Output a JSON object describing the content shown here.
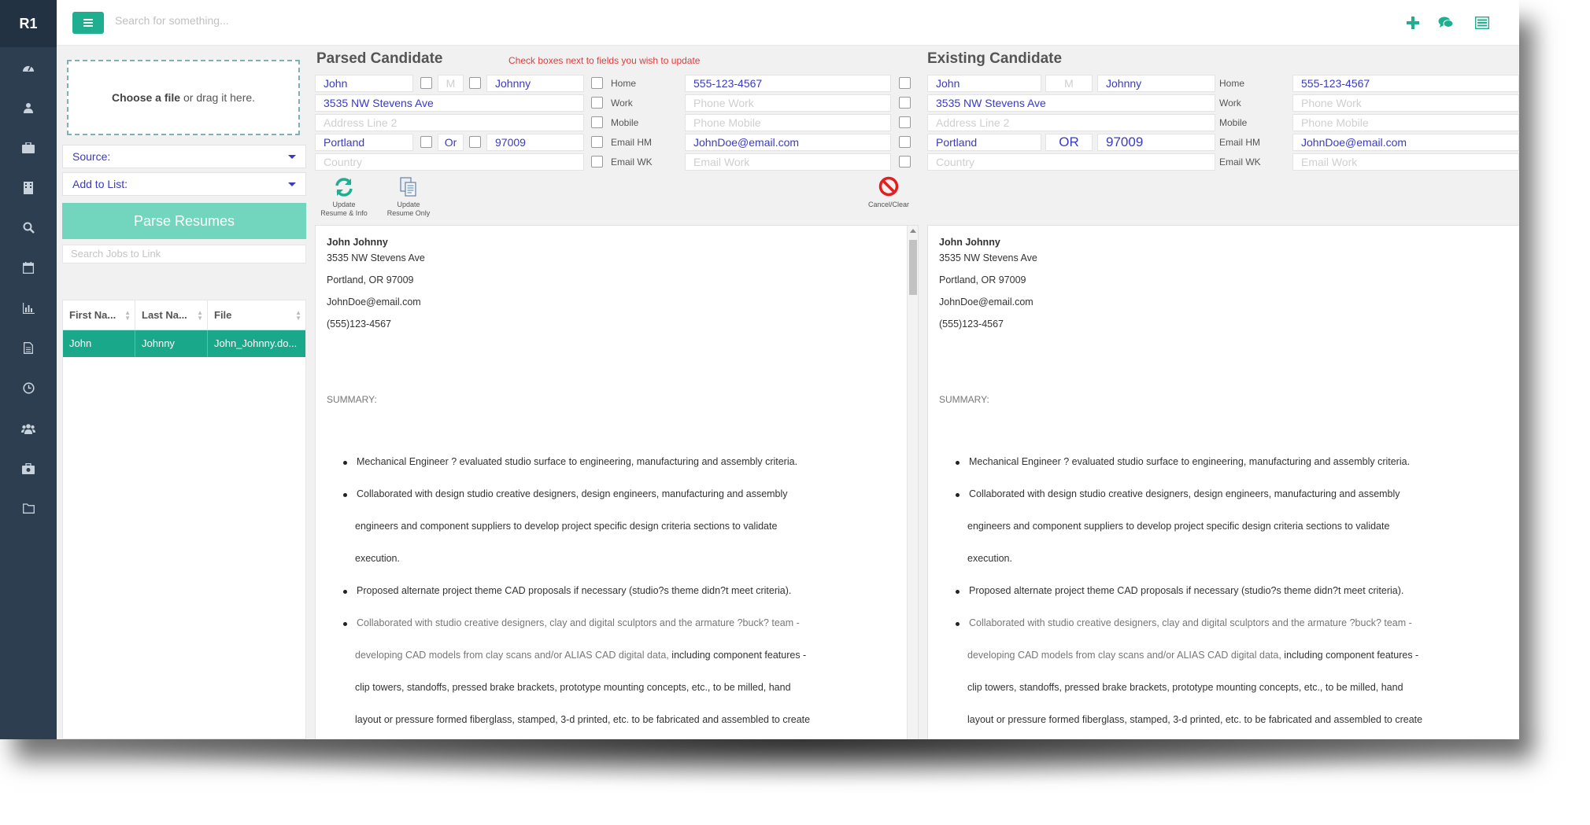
{
  "app": {
    "logo": "R1"
  },
  "topbar": {
    "search_placeholder": "Search for something..."
  },
  "left": {
    "dropzone_strong": "Choose a file",
    "dropzone_rest": " or drag it here.",
    "source_label": "Source:",
    "addlist_label": "Add to List:",
    "parse_button": "Parse Resumes",
    "jobs_placeholder": "Search Jobs to Link",
    "table": {
      "headers": [
        "First Na...",
        "Last Na...",
        "File"
      ],
      "rows": [
        [
          "John",
          "Johnny",
          "John_Johnny.do..."
        ]
      ]
    }
  },
  "parsed": {
    "title": "Parsed Candidate",
    "hint": "Check boxes next to fields you wish to update",
    "first": "John",
    "middle": "M",
    "last": "Johnny",
    "address1": "3535 NW Stevens Ave",
    "address2": "Address Line 2",
    "city": "Portland",
    "state": "Or",
    "zip": "97009",
    "country": "Country",
    "labels": [
      "Home",
      "Work",
      "Mobile",
      "Email HM",
      "Email WK"
    ],
    "home": "555-123-4567",
    "work": "Phone Work",
    "mobile": "Phone Mobile",
    "email_hm": "JohnDoe@email.com",
    "email_wk": "Email Work",
    "tools": {
      "update_all_1": "Update",
      "update_all_2": "Resume & Info",
      "update_resume_1": "Update",
      "update_resume_2": "Resume Only",
      "cancel": "Cancel/Clear"
    }
  },
  "existing": {
    "title": "Existing Candidate",
    "first": "John",
    "middle": "M",
    "last": "Johnny",
    "address1": "3535 NW Stevens Ave",
    "address2": "Address Line 2",
    "city": "Portland",
    "state": "OR",
    "zip": "97009",
    "country": "Country",
    "labels": [
      "Home",
      "Work",
      "Mobile",
      "Email HM",
      "Email WK"
    ],
    "home": "555-123-4567",
    "work": "Phone Work",
    "mobile": "Phone Mobile",
    "email_hm": "JohnDoe@email.com",
    "email_wk": "Email Work"
  },
  "resume": {
    "name": "John Johnny",
    "addr": "3535 NW Stevens Ave",
    "city": "Portland, OR 97009",
    "email": "JohnDoe@email.com",
    "phone": "(555)123-4567",
    "summary": "SUMMARY:",
    "b1": "Mechanical Engineer ? evaluated studio surface to engineering, manufacturing and assembly criteria.",
    "b2": "Collaborated with design studio creative designers, design engineers, manufacturing and assembly",
    "b2a": "engineers and component suppliers to develop project specific design criteria sections to validate",
    "b2b": "execution.",
    "b3": "Proposed alternate project theme CAD proposals if necessary (studio?s theme didn?t meet criteria).",
    "b4": "Collaborated with studio creative designers, clay and digital sculptors and the armature ?buck? team -",
    "b4a": "developing CAD models from clay scans and/or ALIAS CAD digital data,",
    "b4a2": " including component features -",
    "b4b": "clip towers, standoffs, pressed brake brackets, prototype mounting concepts, etc., to be milled, hand",
    "b4c": "layout or pressure formed fiberglass, stamped, 3-d printed, etc. to be fabricated and assembled to create"
  }
}
